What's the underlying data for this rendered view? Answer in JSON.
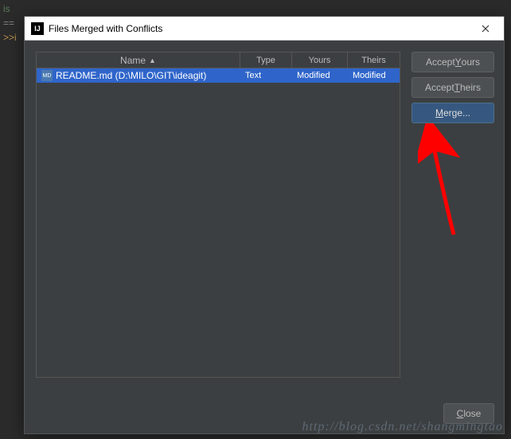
{
  "bg": {
    "line1": "is",
    "line2": "==",
    "line3": ">>i"
  },
  "titlebar": {
    "title": "Files Merged with Conflicts",
    "icon_text": "IJ"
  },
  "table": {
    "headers": {
      "name": "Name",
      "type": "Type",
      "yours": "Yours",
      "theirs": "Theirs"
    },
    "rows": [
      {
        "file": "README.md (D:\\MILO\\GIT\\ideagit)",
        "type": "Text",
        "yours": "Modified",
        "theirs": "Modified"
      }
    ]
  },
  "buttons": {
    "accept_yours_pre": "Accept ",
    "accept_yours_u": "Y",
    "accept_yours_post": "ours",
    "accept_theirs_pre": "Accept ",
    "accept_theirs_u": "T",
    "accept_theirs_post": "heirs",
    "merge_u": "M",
    "merge_post": "erge...",
    "close_u": "C",
    "close_post": "lose"
  },
  "watermark": "http://blog.csdn.net/shangmingtao"
}
